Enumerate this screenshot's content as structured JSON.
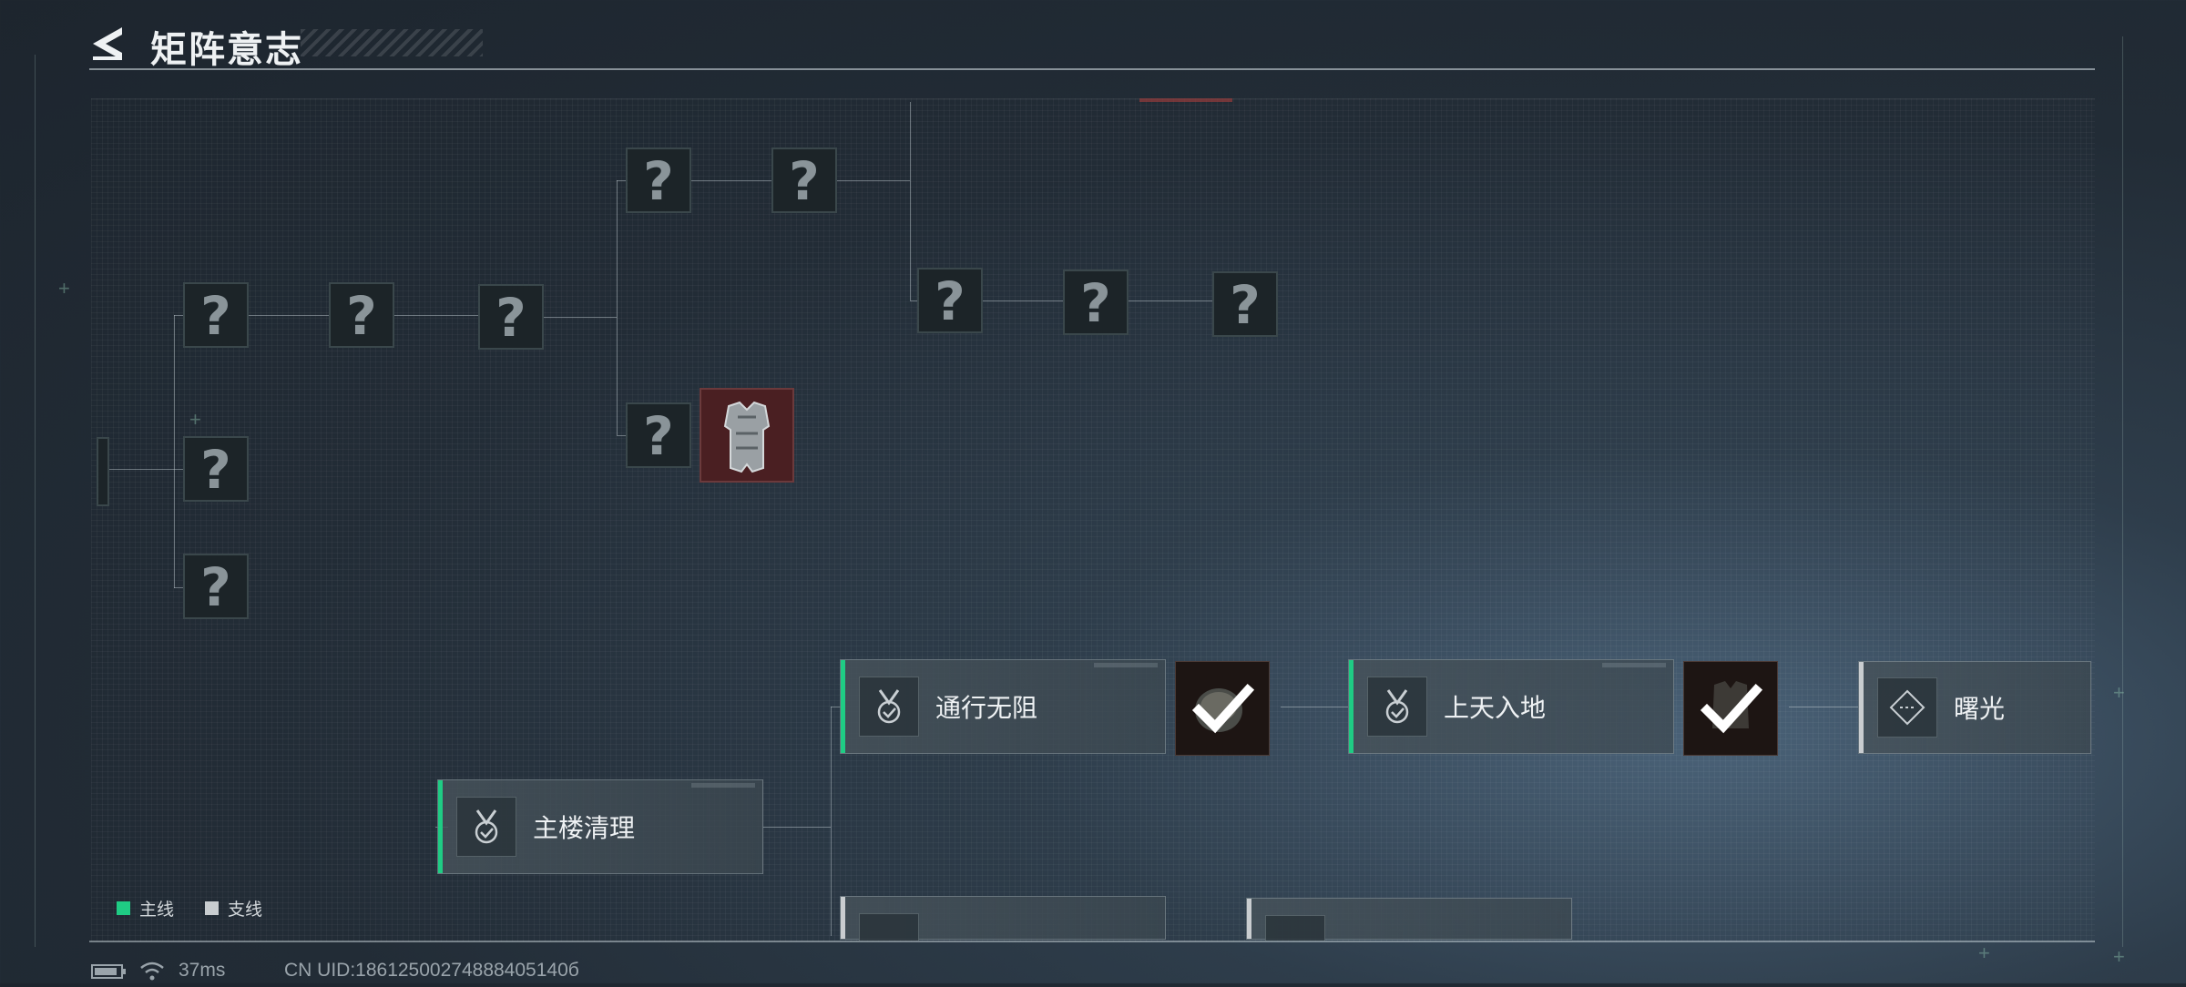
{
  "header": {
    "title": "矩阵意志"
  },
  "tree": {
    "unknown_glyph": "?",
    "locked_nodes": [
      {
        "id": "n1"
      },
      {
        "id": "n2"
      },
      {
        "id": "n3"
      },
      {
        "id": "n4"
      },
      {
        "id": "n5"
      },
      {
        "id": "n6"
      },
      {
        "id": "n7"
      },
      {
        "id": "n8"
      },
      {
        "id": "n9"
      },
      {
        "id": "n10"
      },
      {
        "id": "n11"
      }
    ],
    "reward_icon": "armor-vest-icon"
  },
  "missions": [
    {
      "label": "主楼清理",
      "line": "main",
      "status": "active"
    },
    {
      "label": "通行无阻",
      "line": "main",
      "status": "completed"
    },
    {
      "label": "上天入地",
      "line": "main",
      "status": "completed"
    },
    {
      "label": "曙光",
      "line": "side",
      "status": "locked"
    }
  ],
  "legend": {
    "main_label": "主线",
    "side_label": "支线",
    "main_color": "#1fcc84",
    "side_color": "#c9cdd0"
  },
  "status_bar": {
    "ping": "37ms",
    "uid": "CN UID:18612500274888405140б"
  }
}
